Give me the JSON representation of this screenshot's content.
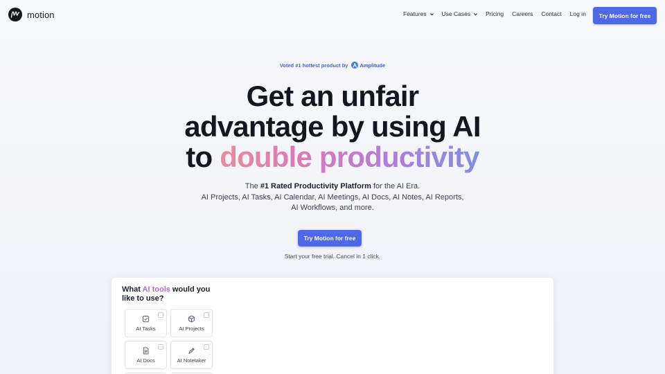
{
  "brand": {
    "name": "motion"
  },
  "nav": {
    "items": [
      {
        "label": "Features",
        "dropdown": true
      },
      {
        "label": "Use Cases",
        "dropdown": true
      },
      {
        "label": "Pricing",
        "dropdown": false
      },
      {
        "label": "Careers",
        "dropdown": false
      },
      {
        "label": "Contact",
        "dropdown": false
      },
      {
        "label": "Log in",
        "dropdown": false
      }
    ],
    "cta": "Try Motion for free"
  },
  "hero": {
    "voted": "Voted #1 hottest product by",
    "amplitude": "Amplitude",
    "headline_line1": "Get an unfair",
    "headline_line2": "advantage by using AI",
    "headline_line3_plain": "to ",
    "headline_line3_gradient": "double productivity",
    "sub_prefix": "The ",
    "sub_bold": "#1 Rated Productivity Platform",
    "sub_suffix": " for the AI Era.",
    "sub_line2": "AI Projects, AI Tasks, AI Calendar, AI Meetings, AI Docs, AI Notes, AI Reports,",
    "sub_line3": "AI Workflows, and more.",
    "cta": "Try Motion for free",
    "trial": "Start your free trial. Cancel in 1 click."
  },
  "panel": {
    "question_prefix": "What ",
    "question_highlight": "AI tools",
    "question_suffix": " would you like to use?",
    "tools": [
      {
        "label": "AI Tasks",
        "icon": "task-check-icon",
        "checked": false
      },
      {
        "label": "AI Projects",
        "icon": "cube-icon",
        "checked": false
      },
      {
        "label": "AI Docs",
        "icon": "document-icon",
        "checked": false
      },
      {
        "label": "AI Notetaker",
        "icon": "pen-icon",
        "checked": false
      }
    ]
  },
  "colors": {
    "accent": "#4f68e8",
    "highlight": "#a36fd4"
  }
}
